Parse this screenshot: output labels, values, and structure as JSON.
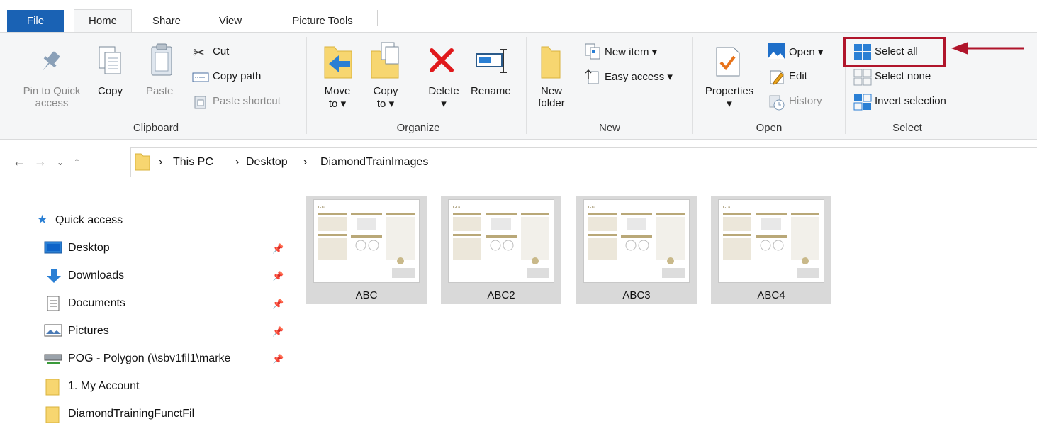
{
  "tabs": {
    "file": "File",
    "home": "Home",
    "share": "Share",
    "view": "View",
    "picture_tools": "Picture Tools"
  },
  "ribbon": {
    "clipboard": {
      "group": "Clipboard",
      "pin_line1": "Pin to Quick",
      "pin_line2": "access",
      "copy": "Copy",
      "paste": "Paste",
      "cut": "Cut",
      "copy_path": "Copy path",
      "paste_shortcut": "Paste shortcut"
    },
    "organize": {
      "group": "Organize",
      "move_line1": "Move",
      "move_line2": "to ▾",
      "copy_line1": "Copy",
      "copy_line2": "to ▾",
      "delete": "Delete",
      "delete_arrow": "▾",
      "rename": "Rename"
    },
    "new": {
      "group": "New",
      "new_folder_line1": "New",
      "new_folder_line2": "folder",
      "new_item": "New item ▾",
      "easy_access": "Easy access ▾"
    },
    "open": {
      "group": "Open",
      "properties": "Properties",
      "properties_arrow": "▾",
      "open": "Open ▾",
      "edit": "Edit",
      "history": "History"
    },
    "select": {
      "group": "Select",
      "select_all": "Select all",
      "select_none": "Select none",
      "invert_selection": "Invert selection"
    }
  },
  "address": {
    "sep": "›",
    "crumbs": [
      "This PC",
      "Desktop",
      "DiamondTrainImages"
    ]
  },
  "sidebar": {
    "quick_access": "Quick access",
    "items": [
      {
        "label": "Desktop",
        "pinned": true
      },
      {
        "label": "Downloads",
        "pinned": true
      },
      {
        "label": "Documents",
        "pinned": true
      },
      {
        "label": "Pictures",
        "pinned": true
      },
      {
        "label": "POG - Polygon (\\\\sbv1fil1\\marke",
        "pinned": true
      },
      {
        "label": "1. My Account",
        "pinned": false
      },
      {
        "label": "DiamondTrainingFunctFil",
        "pinned": false
      }
    ]
  },
  "files": [
    {
      "name": "ABC"
    },
    {
      "name": "ABC2"
    },
    {
      "name": "ABC3"
    },
    {
      "name": "ABC4"
    }
  ],
  "thumb_logo": "GIA",
  "colors": {
    "accent": "#1a62b4",
    "highlight": "#b0152b",
    "selected_tile": "#d9d9d9"
  }
}
